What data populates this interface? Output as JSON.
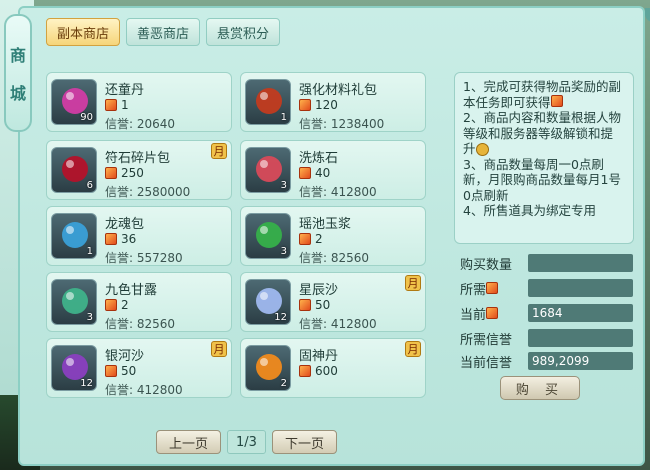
{
  "sidebar": {
    "title_top": "商",
    "title_bottom": "城"
  },
  "tabs": [
    {
      "label": "副本商店",
      "active": true
    },
    {
      "label": "善恶商店",
      "active": false
    },
    {
      "label": "悬赏积分",
      "active": false
    }
  ],
  "items": [
    {
      "name": "还童丹",
      "price": "1",
      "reputation": "信誉: 20640",
      "count": "90",
      "monthly": false,
      "icon": "pink-orb-icon",
      "color": "#d13ca4"
    },
    {
      "name": "强化材料礼包",
      "price": "120",
      "reputation": "信誉: 1238400",
      "count": "1",
      "monthly": false,
      "icon": "red-bag-icon",
      "color": "#c23b1f"
    },
    {
      "name": "符石碎片包",
      "price": "250",
      "reputation": "信誉: 2580000",
      "count": "6",
      "monthly": true,
      "icon": "crimson-bag-icon",
      "color": "#b3122a"
    },
    {
      "name": "洗炼石",
      "price": "40",
      "reputation": "信誉: 412800",
      "count": "3",
      "monthly": false,
      "icon": "crystal-icon",
      "color": "#d84a5a"
    },
    {
      "name": "龙魂包",
      "price": "36",
      "reputation": "信誉: 557280",
      "count": "1",
      "monthly": false,
      "icon": "blue-bag-icon",
      "color": "#3aa0d8"
    },
    {
      "name": "瑶池玉浆",
      "price": "2",
      "reputation": "信誉: 82560",
      "count": "3",
      "monthly": false,
      "icon": "green-bottle-icon",
      "color": "#36b04a"
    },
    {
      "name": "九色甘露",
      "price": "2",
      "reputation": "信誉: 82560",
      "count": "3",
      "monthly": false,
      "icon": "green-leaf-icon",
      "color": "#3fb28a"
    },
    {
      "name": "星辰沙",
      "price": "50",
      "reputation": "信誉: 412800",
      "count": "12",
      "monthly": true,
      "icon": "star-sand-icon",
      "color": "#9fb8ef"
    },
    {
      "name": "银河沙",
      "price": "50",
      "reputation": "信誉: 412800",
      "count": "12",
      "monthly": true,
      "icon": "purple-bottle-icon",
      "color": "#8a3fc0"
    },
    {
      "name": "固神丹",
      "price": "600",
      "reputation": "",
      "count": "2",
      "monthly": true,
      "icon": "flame-orb-icon",
      "color": "#f08a1c"
    }
  ],
  "month_badge": "月",
  "notice": {
    "line1": "1、完成可获得物品奖励的副本任务即可获得",
    "line2": "2、商品内容和数量根据人物等级和服务器等级解锁和提升",
    "line3": "3、商品数量每周一0点刷新，月限购商品数量每月1号0点刷新",
    "line4": "4、所售道具为绑定专用"
  },
  "form": {
    "buy_qty_label": "购买数量",
    "buy_qty_value": "",
    "required_label": "所需",
    "required_value": "",
    "current_label": "当前",
    "current_value": "1684",
    "required_rep_label": "所需信誉",
    "required_rep_value": "",
    "current_rep_label": "当前信誉",
    "current_rep_value": "989,2099"
  },
  "buy_button": "购 买",
  "pager": {
    "prev": "上一页",
    "info": "1/3",
    "next": "下一页"
  }
}
